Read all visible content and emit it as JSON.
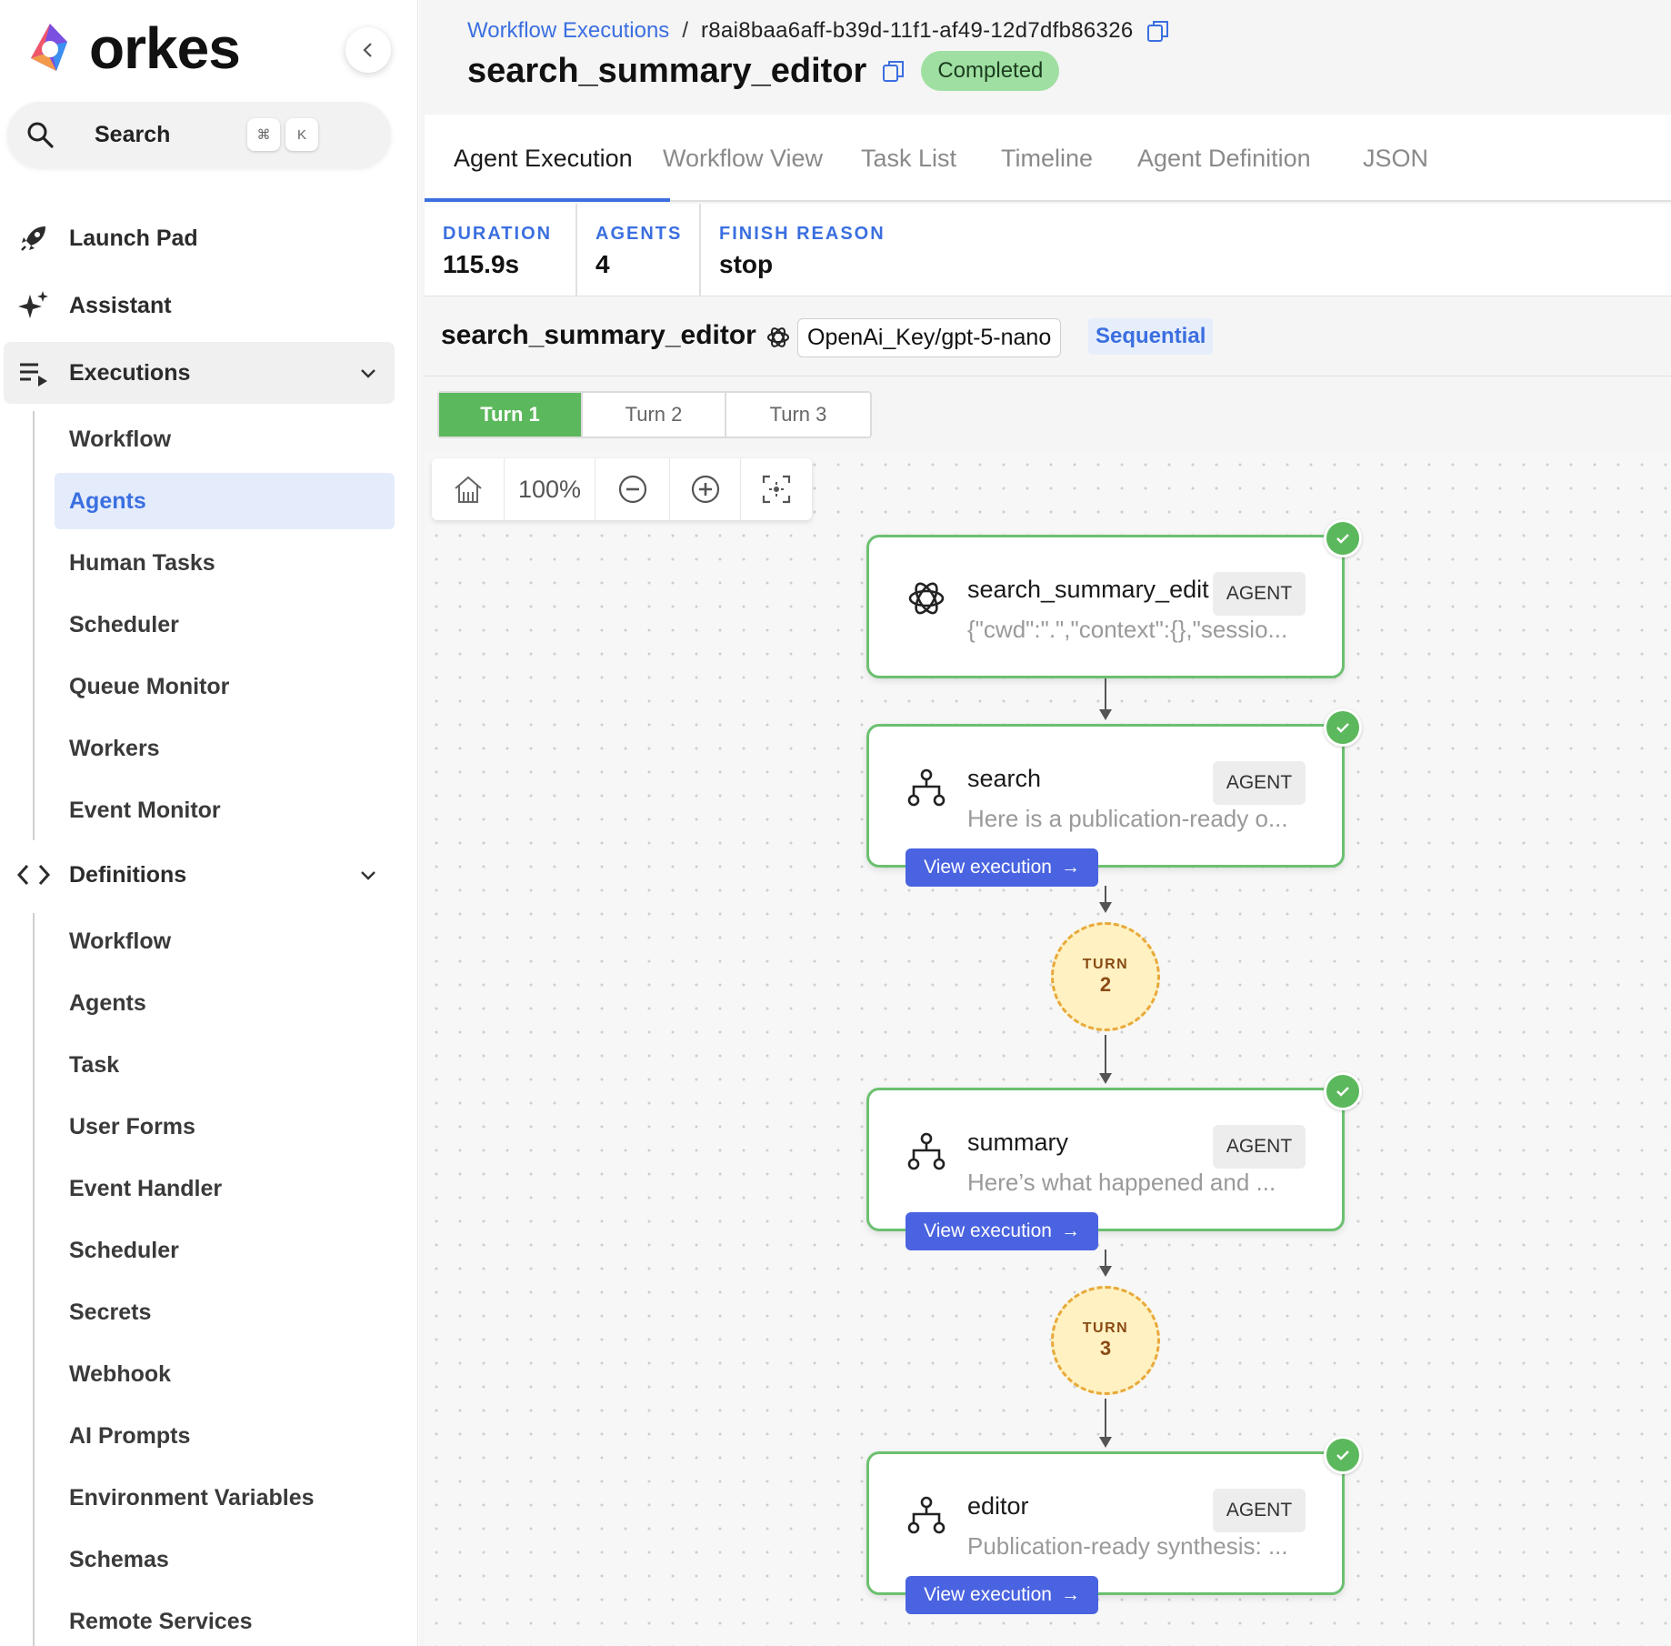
{
  "app": {
    "logo_text": "orkes"
  },
  "search": {
    "label": "Search",
    "shortcut_mod": "⌘",
    "shortcut_key": "K"
  },
  "nav": {
    "launch_pad": "Launch Pad",
    "assistant": "Assistant",
    "executions": "Executions",
    "executions_items": [
      "Workflow",
      "Agents",
      "Human Tasks",
      "Scheduler",
      "Queue Monitor",
      "Workers",
      "Event Monitor"
    ],
    "active_execution_item": "Agents",
    "definitions": "Definitions",
    "definitions_items": [
      "Workflow",
      "Agents",
      "Task",
      "User Forms",
      "Event Handler",
      "Scheduler",
      "Secrets",
      "Webhook",
      "AI Prompts",
      "Environment Variables",
      "Schemas",
      "Remote Services"
    ]
  },
  "header": {
    "breadcrumb_link": "Workflow Executions",
    "breadcrumb_sep": "/",
    "execution_id": "r8ai8baa6aff-b39d-11f1-af49-12d7dfb86326",
    "title": "search_summary_editor",
    "status": "Completed",
    "status_color": "#9fe0a2"
  },
  "tabs": [
    "Agent Execution",
    "Workflow View",
    "Task List",
    "Timeline",
    "Agent Definition",
    "JSON"
  ],
  "active_tab": "Agent Execution",
  "stats": {
    "duration_label": "DURATION",
    "duration_value": "115.9s",
    "agents_label": "AGENTS",
    "agents_value": "4",
    "finish_label": "FINISH REASON",
    "finish_value": "stop"
  },
  "agent": {
    "name": "search_summary_editor",
    "model": "OpenAi_Key/gpt-5-nano",
    "strategy": "Sequential"
  },
  "turns": [
    "Turn 1",
    "Turn 2",
    "Turn 3"
  ],
  "active_turn": "Turn 1",
  "zoom": {
    "level": "100%"
  },
  "graph": {
    "nodes": [
      {
        "title": "search_summary_edit",
        "tag": "AGENT",
        "desc": "{\"cwd\":\".\",\"context\":{},\"sessio...",
        "icon": "openai-icon",
        "status": "completed"
      },
      {
        "title": "search",
        "tag": "AGENT",
        "desc": "Here is a publication-ready o...",
        "icon": "agent-tree-icon",
        "button": "View execution",
        "status": "completed"
      },
      {
        "title": "summary",
        "tag": "AGENT",
        "desc": "Here’s what happened and ...",
        "icon": "agent-tree-icon",
        "button": "View execution",
        "status": "completed"
      },
      {
        "title": "editor",
        "tag": "AGENT",
        "desc": "Publication-ready synthesis: ...",
        "icon": "agent-tree-icon",
        "button": "View execution",
        "status": "completed"
      }
    ],
    "turn_markers": [
      {
        "label": "TURN",
        "number": "2"
      },
      {
        "label": "TURN",
        "number": "3"
      }
    ]
  },
  "colors": {
    "accent": "#3b6fe0",
    "success": "#5cb85c",
    "button": "#4a63e0",
    "turn_fill": "#fff1c2",
    "turn_border": "#e8a93a"
  }
}
